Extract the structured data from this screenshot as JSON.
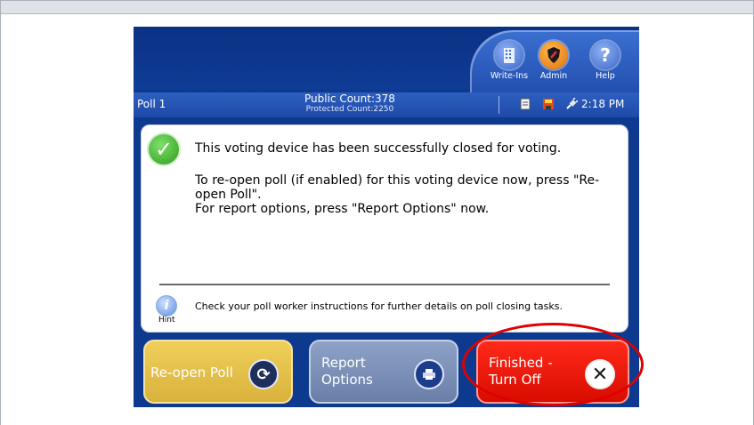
{
  "header": {
    "nav": [
      {
        "label": "Write-Ins",
        "icon": "building-icon"
      },
      {
        "label": "Admin",
        "icon": "shield-icon"
      },
      {
        "label": "Help",
        "icon": "question-icon"
      }
    ]
  },
  "status": {
    "poll_label": "Poll 1",
    "public_count": "Public Count:378",
    "protected_count": "Protected Count:2250",
    "time": "2:18 PM",
    "icons": [
      "document-icon",
      "save-disk-icon",
      "power-plug-icon"
    ]
  },
  "panel": {
    "message_main": "This voting device has been successfully closed for voting.",
    "message_reopen": "To re-open poll (if enabled) for this voting device now, press \"Re-open Poll\".",
    "message_report": "For report options, press \"Report Options\" now.",
    "hint_label": "Hint",
    "hint_text": "Check your poll worker instructions for further details on poll closing tasks."
  },
  "buttons": {
    "reopen": {
      "label": "Re-open Poll",
      "icon": "refresh-icon"
    },
    "report": {
      "label_line1": "Report",
      "label_line2": "Options",
      "icon": "printer-icon"
    },
    "finish": {
      "label_line1": "Finished -",
      "label_line2": "Turn Off",
      "icon": "close-x-icon"
    }
  },
  "colors": {
    "device_blue": "#0d3a8e",
    "reopen_yellow": "#e3c04a",
    "report_gray_blue": "#7a8fb8",
    "finish_red": "#e81a0c",
    "highlight_red": "#e00000"
  }
}
